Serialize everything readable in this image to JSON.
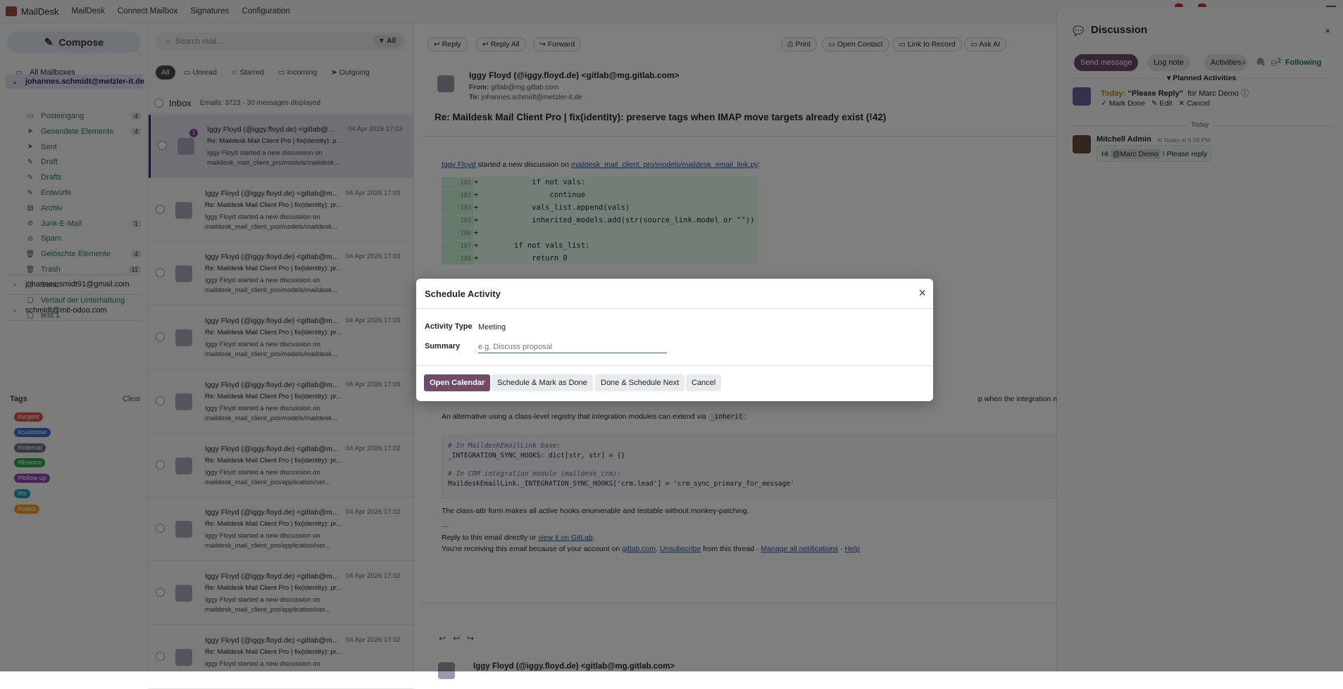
{
  "topbar": {
    "app": "MailDesk",
    "menu": [
      "MailDesk",
      "Connect Mailbox",
      "Signatures",
      "Configuration"
    ]
  },
  "sidebar": {
    "compose": "Compose",
    "all_mailboxes": "All Mailboxes",
    "account1": "johannes.schmidt@metzler-it.de",
    "folders": [
      {
        "label": "Posteingang",
        "count": "4",
        "icon": "inbox-icon"
      },
      {
        "label": "Gesendete Elemente",
        "count": "4",
        "icon": "send-icon"
      },
      {
        "label": "Sent",
        "count": "",
        "icon": "send-icon"
      },
      {
        "label": "Draft",
        "count": "",
        "icon": "draft-icon"
      },
      {
        "label": "Drafts",
        "count": "",
        "icon": "draft-icon"
      },
      {
        "label": "Entwürfe",
        "count": "",
        "icon": "draft-icon"
      },
      {
        "label": "Archiv",
        "count": "",
        "icon": "archive-icon"
      },
      {
        "label": "Junk-E-Mail",
        "count": "1",
        "icon": "ban-icon"
      },
      {
        "label": "Spam",
        "count": "",
        "icon": "ban-icon"
      },
      {
        "label": "Gelöschte Elemente",
        "count": "4",
        "icon": "trash-icon"
      },
      {
        "label": "Trash",
        "count": "11",
        "icon": "trash-icon"
      },
      {
        "label": "Send",
        "count": "",
        "icon": "folder-icon"
      },
      {
        "label": "Verlauf der Unterhaltung",
        "count": "",
        "icon": "folder-icon"
      },
      {
        "label": "test 1",
        "count": "",
        "icon": "folder-icon"
      }
    ],
    "account2": "johannes.smidt91@gmail.com",
    "account3": "schmidt@mit-odoo.com",
    "tags_title": "Tags",
    "tags_clear": "Clear",
    "tags": [
      {
        "label": "#urgent",
        "color": "#d9534f"
      },
      {
        "label": "#customer",
        "color": "#3a6fd0"
      },
      {
        "label": "#internal",
        "color": "#6c757d"
      },
      {
        "label": "#finance",
        "color": "#28a745"
      },
      {
        "label": "#follow-up",
        "color": "#8e44ad"
      },
      {
        "label": "#hr",
        "color": "#17a2b8"
      },
      {
        "label": "#sales",
        "color": "#f39c12"
      }
    ]
  },
  "list": {
    "search_placeholder": "Search mail...",
    "filter": "All",
    "tabs": [
      "All",
      "Unread",
      "Starred",
      "Incoming",
      "Outgoing"
    ],
    "inbox": "Inbox",
    "stats": "Emails: 3723 · 30 messages displayed",
    "messages": [
      {
        "from": "Iggy Floyd (@iggy.floyd.de) <gitlab@...",
        "date": "04 Apr 2026 17:03",
        "subject": "Re: Maildesk Mail Client Pro | fix(identity): pre...",
        "preview": "Iggy Floyd started a new discussion on maildesk_mail_client_pro/models/maildesk...",
        "badge": "1"
      },
      {
        "from": "Iggy Floyd (@iggy.floyd.de) <gitlab@m...",
        "date": "04 Apr 2026 17:03",
        "subject": "Re: Maildesk Mail Client Pro | fix(identity): pr...",
        "preview": "Iggy Floyd started a new discussion on maildesk_mail_client_pro/models/maildesk...",
        "badge": ""
      },
      {
        "from": "Iggy Floyd (@iggy.floyd.de) <gitlab@m...",
        "date": "04 Apr 2026 17:03",
        "subject": "Re: Maildesk Mail Client Pro | fix(identity): pr...",
        "preview": "Iggy Floyd started a new discussion on maildesk_mail_client_pro/models/maildesk...",
        "badge": ""
      },
      {
        "from": "Iggy Floyd (@iggy.floyd.de) <gitlab@m...",
        "date": "04 Apr 2026 17:03",
        "subject": "Re: Maildesk Mail Client Pro | fix(identity): pr...",
        "preview": "Iggy Floyd started a new discussion on maildesk_mail_client_pro/models/maildesk...",
        "badge": ""
      },
      {
        "from": "Iggy Floyd (@iggy.floyd.de) <gitlab@m...",
        "date": "04 Apr 2026 17:03",
        "subject": "Re: Maildesk Mail Client Pro | fix(identity): pr...",
        "preview": "Iggy Floyd started a new discussion on maildesk_mail_client_pro/models/maildesk...",
        "badge": ""
      },
      {
        "from": "Iggy Floyd (@iggy.floyd.de) <gitlab@m...",
        "date": "04 Apr 2026 17:02",
        "subject": "Re: Maildesk Mail Client Pro | fix(identity): pr...",
        "preview": "Iggy Floyd started a new discussion on maildesk_mail_client_pro/application/ser...",
        "badge": ""
      },
      {
        "from": "Iggy Floyd (@iggy.floyd.de) <gitlab@m...",
        "date": "04 Apr 2026 17:02",
        "subject": "Re: Maildesk Mail Client Pro | fix(identity): pr...",
        "preview": "Iggy Floyd started a new discussion on maildesk_mail_client_pro/application/ser...",
        "badge": ""
      },
      {
        "from": "Iggy Floyd (@iggy.floyd.de) <gitlab@m...",
        "date": "04 Apr 2026 17:02",
        "subject": "Re: Maildesk Mail Client Pro | fix(identity): pr...",
        "preview": "Iggy Floyd started a new discussion on maildesk_mail_client_pro/application/ser...",
        "badge": ""
      },
      {
        "from": "Iggy Floyd (@iggy.floyd.de) <gitlab@m...",
        "date": "04 Apr 2026 17:02",
        "subject": "Re: Maildesk Mail Client Pro | fix(identity): pr...",
        "preview": "Iggy Floyd started a new discussion on",
        "badge": ""
      }
    ]
  },
  "reader": {
    "toolbar": [
      "Reply",
      "Reply All",
      "Forward"
    ],
    "toolbar_right": [
      "Print",
      "Open Contact",
      "Link to Record",
      "Ask AI"
    ],
    "from_full": "Iggy Floyd (@iggy.floyd.de) <gitlab@mg.gitlab.com>",
    "from_label": "From:",
    "from_addr": "gitlab@mg.gitlab.com",
    "to_label": "To:",
    "to_addr": "johannes.schmidt@metzler-it.de",
    "subject": "Re: Maildesk Mail Client Pro | fix(identity): preserve tags when IMAP move targets already exist (!42)",
    "intro_author": "Iggy Floyd",
    "intro_text": " started a new discussion on ",
    "intro_file": "maildesk_mail_client_pro/models/maildesk_email_link.py",
    "intro_colon": ":",
    "code_lines": [
      {
        "n": "182",
        "t": "            if not vals:"
      },
      {
        "n": "183",
        "t": "                continue"
      },
      {
        "n": "184",
        "t": "            vals_list.append(vals)"
      },
      {
        "n": "185",
        "t": "            inherited_models.add(str(source_link.model or \"\"))"
      },
      {
        "n": "186",
        "t": ""
      },
      {
        "n": "187",
        "t": "        if not vals_list:"
      },
      {
        "n": "188",
        "t": "            return 0"
      },
      {
        "n": "189",
        "t": ""
      }
    ],
    "partial_right": "p when the integration module is not",
    "alt_text": "An alternative using a class-level registry that integration modules can extend via ",
    "alt_code": "_inherit",
    "alt_end": ":",
    "code2": [
      "# In MaildeskEmailLink base:",
      "_INTEGRATION_SYNC_HOOKS: dict[str, str] = {}",
      "",
      "# In CRM integration module (maildesk_crm):",
      "MaildeskEmailLink._INTEGRATION_SYNC_HOOKS['crm.lead'] = 'crm_sync_primary_for_message'"
    ],
    "classattr": "The class-attr form makes all active hooks enumerable and testable without monkey-patching.",
    "sig": "—",
    "reply_text": "Reply to this email directly or ",
    "reply_link": "view it on GitLab",
    "reply_end": ".",
    "recv1": "You're receiving this email because of your account on ",
    "recv_link1": "gitlab.com",
    "recv_dot": ". ",
    "recv_link2": "Unsubscribe",
    "recv2": " from this thread · ",
    "recv_link3": "Manage all notifications",
    "recv_sep": " · ",
    "recv_link4": "Help",
    "next_from": "Iggy Floyd (@iggy.floyd.de) <gitlab@mg.gitlab.com>"
  },
  "discussion": {
    "title": "Discussion",
    "send": "Send message",
    "log": "Log note",
    "activities": "Activities",
    "followers": "2",
    "following": "Following",
    "planned": "Planned Activities",
    "today_label": "Today:",
    "activity_title": "“Please Reply”",
    "activity_for": "for Marc Demo",
    "mark_done": "Mark Done",
    "edit": "Edit",
    "cancel": "Cancel",
    "divider": "Today",
    "author": "Mitchell Admin",
    "time": "Today at 6:28 PM",
    "msg_pre": "Hi ",
    "mention": "@Marc Demo",
    "msg_post": " ! Please reply"
  },
  "modal": {
    "title": "Schedule Activity",
    "type_label": "Activity Type",
    "type_value": "Meeting",
    "summary_label": "Summary",
    "summary_placeholder": "e.g. Discuss proposal",
    "buttons": [
      "Open Calendar",
      "Schedule & Mark as Done",
      "Done & Schedule Next",
      "Cancel"
    ]
  }
}
